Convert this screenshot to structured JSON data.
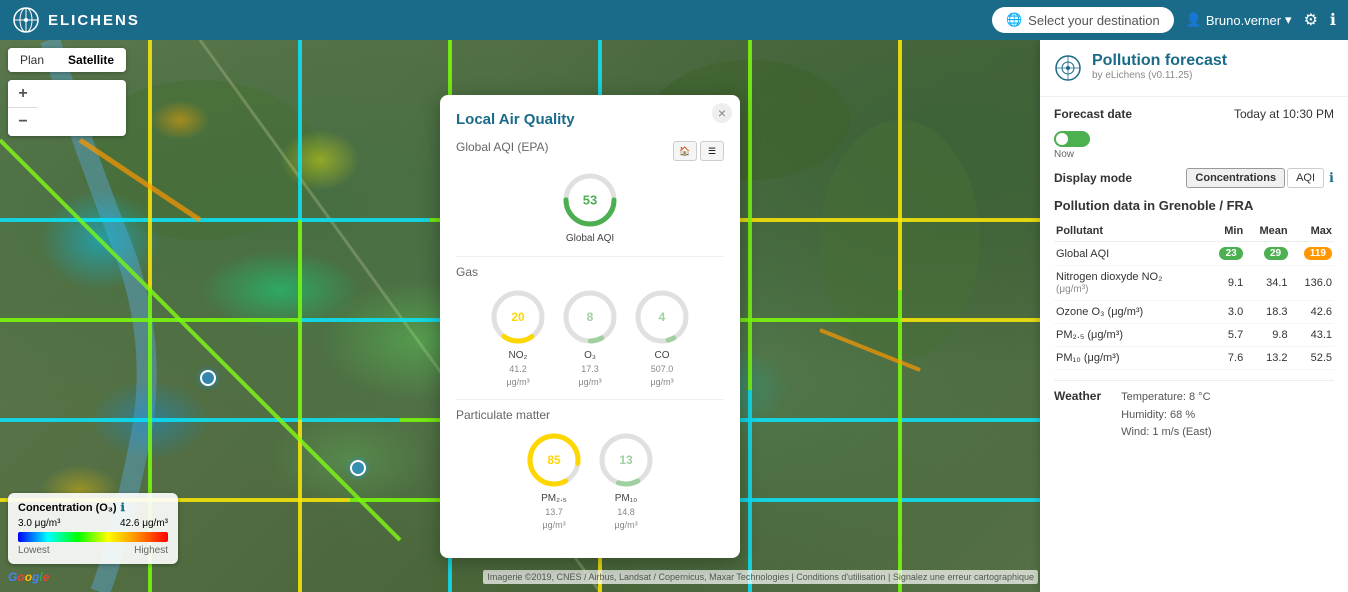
{
  "header": {
    "brand": "ELICHENS",
    "destination_placeholder": "Select your destination",
    "user": "Bruno.verner",
    "settings_icon": "gear",
    "info_icon": "info"
  },
  "map": {
    "type_buttons": [
      "Plan",
      "Satellite"
    ],
    "active_type": "Satellite",
    "zoom_in": "+",
    "zoom_out": "−"
  },
  "legend": {
    "title": "Concentration (O₃)",
    "min_value": "3.0 μg/m³",
    "max_value": "42.6 μg/m³",
    "min_label": "Lowest",
    "max_label": "Highest"
  },
  "google_logo": "Google",
  "attribution": "Imagerie ©2019, CNES / Airbus, Landsat / Copernicus, Maxar Technologies | Conditions d'utilisation | Signalez une erreur cartographique",
  "laq_popup": {
    "title": "Local Air Quality",
    "close": "×",
    "global_aqi_label": "Global AQI (EPA)",
    "global_aqi_value": 53,
    "global_aqi_sub": "Global AQI",
    "gas_label": "Gas",
    "pollutants": [
      {
        "name": "NO₂",
        "value": 20,
        "sub1": "41.2",
        "sub2": "μg/m³",
        "color": "#ffd700"
      },
      {
        "name": "O₃",
        "value": 8,
        "sub1": "17.3",
        "sub2": "μg/m³",
        "color": "#a0d0a0"
      },
      {
        "name": "CO",
        "value": 4,
        "sub1": "507.0",
        "sub2": "μg/m³",
        "color": "#a0d0a0"
      }
    ],
    "pm_label": "Particulate matter",
    "pm_pollutants": [
      {
        "name": "PM₂.₅",
        "value": 85,
        "sub1": "13.7",
        "sub2": "μg/m³",
        "color": "#ffd700"
      },
      {
        "name": "PM₁₀",
        "value": 13,
        "sub1": "14.8",
        "sub2": "μg/m³",
        "color": "#a0d0a0"
      }
    ]
  },
  "right_panel": {
    "title": "Pollution forecast",
    "subtitle": "by eLichens (v0.11.25)",
    "forecast_label": "Forecast date",
    "forecast_value": "Today at 10:30 PM",
    "now_label": "Now",
    "display_mode_label": "Display mode",
    "display_modes": [
      "Concentrations",
      "AQI"
    ],
    "active_mode": "Concentrations",
    "pollution_data_title": "Pollution data in Grenoble / FRA",
    "table_headers": [
      "Pollutant",
      "Min",
      "Mean",
      "Max"
    ],
    "table_rows": [
      {
        "name": "Global AQI",
        "min": "23",
        "mean": "29",
        "max": "119",
        "min_color": "green",
        "mean_color": "green",
        "max_color": "orange",
        "is_badge": true
      },
      {
        "name": "Nitrogen dioxyde NO₂\n(μg/m³)",
        "min": "9.1",
        "mean": "34.1",
        "max": "136.0",
        "is_badge": false
      },
      {
        "name": "Ozone O₃ (μg/m³)",
        "min": "3.0",
        "mean": "18.3",
        "max": "42.6",
        "is_badge": false
      },
      {
        "name": "PM₂.₅ (μg/m³)",
        "min": "5.7",
        "mean": "9.8",
        "max": "43.1",
        "is_badge": false
      },
      {
        "name": "PM₁₀ (μg/m³)",
        "min": "7.6",
        "mean": "13.2",
        "max": "52.5",
        "is_badge": false
      }
    ],
    "weather_label": "Weather",
    "weather_details": "Temperature: 8 °C\nHumidity: 68 %\nWind: 1 m/s (East)"
  }
}
